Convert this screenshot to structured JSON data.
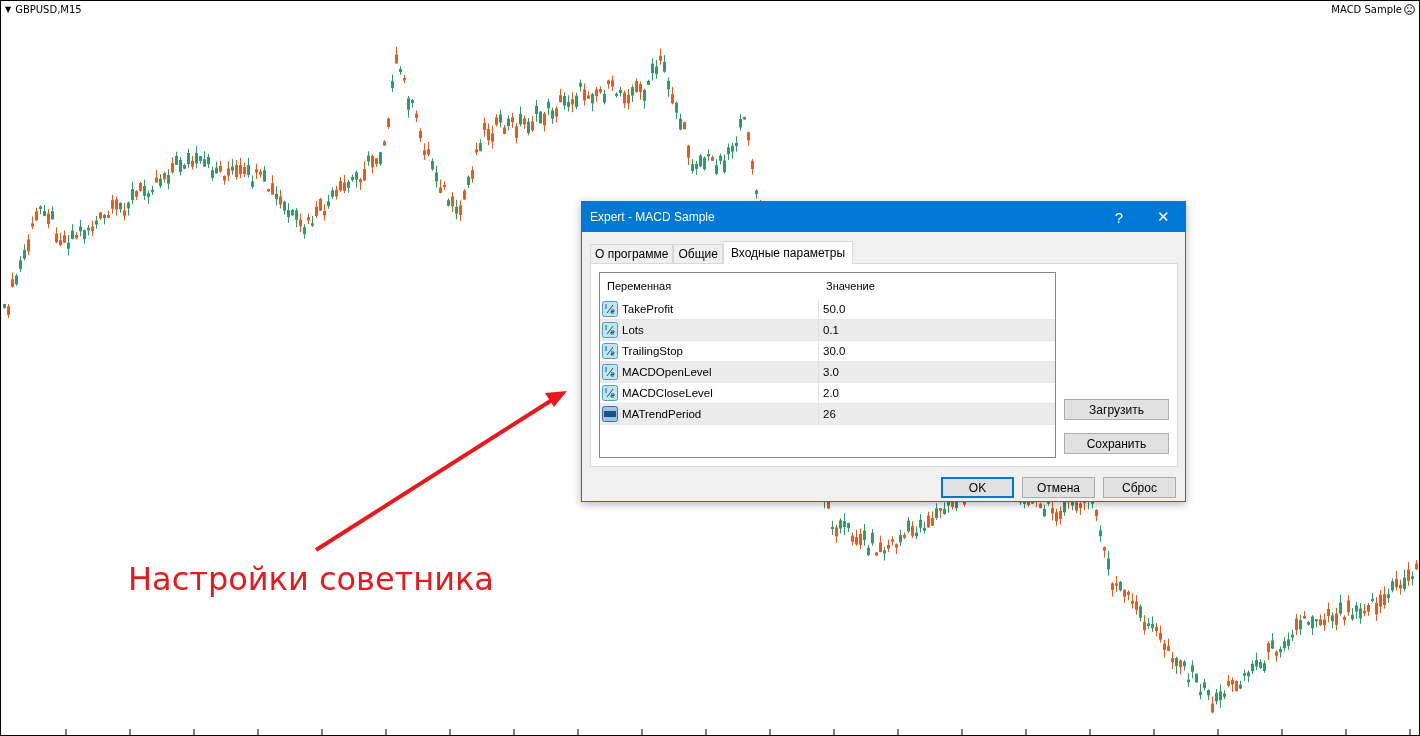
{
  "chart": {
    "symbol": "GBPUSD,M15",
    "symbol_icon": "▼",
    "expert_name": "MACD Sample"
  },
  "dialog": {
    "title": "Expert - MACD Sample",
    "help": "?",
    "close": "✕",
    "tabs": [
      {
        "label": "О программе",
        "selected": false
      },
      {
        "label": "Общие",
        "selected": false
      },
      {
        "label": "Входные параметры",
        "selected": true
      }
    ],
    "table": {
      "columns": [
        "Переменная",
        "Значение"
      ],
      "rows": [
        {
          "kind": "double",
          "name": "TakeProfit",
          "value": "50.0"
        },
        {
          "kind": "double",
          "name": "Lots",
          "value": "0.1"
        },
        {
          "kind": "double",
          "name": "TrailingStop",
          "value": "30.0"
        },
        {
          "kind": "double",
          "name": "MACDOpenLevel",
          "value": "3.0"
        },
        {
          "kind": "double",
          "name": "MACDCloseLevel",
          "value": "2.0"
        },
        {
          "kind": "integer",
          "name": "MATrendPeriod",
          "value": "26"
        }
      ]
    },
    "side_buttons": [
      "Загрузить",
      "Сохранить"
    ],
    "buttons": [
      {
        "label": "OK",
        "default": true
      },
      {
        "label": "Отмена",
        "default": false
      },
      {
        "label": "Сброс",
        "default": false
      }
    ]
  },
  "annotation": {
    "caption": "Настройки советника"
  }
}
